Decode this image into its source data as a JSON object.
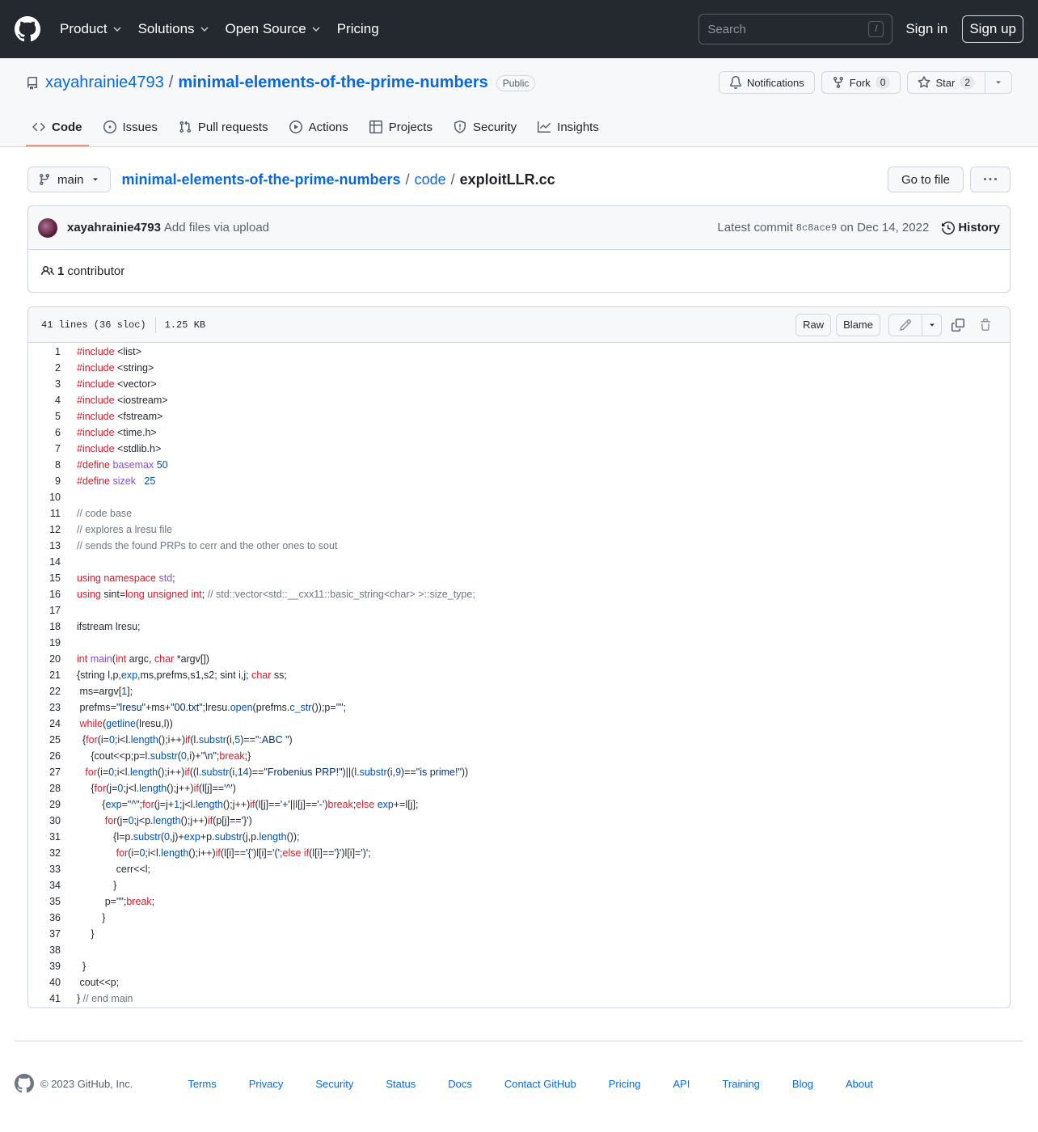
{
  "header": {
    "nav": [
      "Product",
      "Solutions",
      "Open Source",
      "Pricing"
    ],
    "search_placeholder": "Search",
    "search_shortcut": "/",
    "signin": "Sign in",
    "signup": "Sign up"
  },
  "repo": {
    "owner": "xayahrainie4793",
    "separator": "/",
    "name": "minimal-elements-of-the-prime-numbers",
    "visibility": "Public",
    "notifications_label": "Notifications",
    "fork_label": "Fork",
    "fork_count": "0",
    "star_label": "Star",
    "star_count": "2"
  },
  "tabs": [
    "Code",
    "Issues",
    "Pull requests",
    "Actions",
    "Projects",
    "Security",
    "Insights"
  ],
  "file": {
    "branch": "main",
    "breadcrumb": [
      "minimal-elements-of-the-prime-numbers",
      "code",
      "exploitLLR.cc"
    ],
    "go_to_file": "Go to file"
  },
  "commit": {
    "author": "xayahrainie4793",
    "message": "Add files via upload",
    "latest_label": "Latest commit",
    "sha": "8c8ace9",
    "date": "on Dec 14, 2022",
    "history": "History",
    "contributors_count": "1",
    "contributors_label": "contributor"
  },
  "file_view": {
    "lines_info": "41 lines (36 sloc)",
    "size": "1.25 KB",
    "raw": "Raw",
    "blame": "Blame"
  },
  "code_lines": [
    [
      [
        "k",
        "#include"
      ],
      [
        "",
        " <list>"
      ]
    ],
    [
      [
        "k",
        "#include"
      ],
      [
        "",
        " <string>"
      ]
    ],
    [
      [
        "k",
        "#include"
      ],
      [
        "",
        " <vector>"
      ]
    ],
    [
      [
        "k",
        "#include"
      ],
      [
        "",
        " <iostream>"
      ]
    ],
    [
      [
        "k",
        "#include"
      ],
      [
        "",
        " <fstream>"
      ]
    ],
    [
      [
        "k",
        "#include"
      ],
      [
        "",
        " <time.h>"
      ]
    ],
    [
      [
        "k",
        "#include"
      ],
      [
        "",
        " <stdlib.h>"
      ]
    ],
    [
      [
        "k",
        "#define"
      ],
      [
        "",
        " "
      ],
      [
        "f",
        "basemax"
      ],
      [
        "",
        " "
      ],
      [
        "b",
        "50"
      ]
    ],
    [
      [
        "k",
        "#define"
      ],
      [
        "",
        " "
      ],
      [
        "f",
        "sizek"
      ],
      [
        "",
        "   "
      ],
      [
        "b",
        "25"
      ]
    ],
    [],
    [
      [
        "cm",
        "// code base"
      ]
    ],
    [
      [
        "cm",
        "// explores a lresu file"
      ]
    ],
    [
      [
        "cm",
        "// sends the found PRPs to cerr and the other ones to sout"
      ]
    ],
    [],
    [
      [
        "k",
        "using namespace"
      ],
      [
        "",
        " "
      ],
      [
        "f",
        "std"
      ],
      [
        "",
        ";"
      ]
    ],
    [
      [
        "k",
        "using"
      ],
      [
        "",
        " sint="
      ],
      [
        "k",
        "long unsigned int"
      ],
      [
        "",
        "; "
      ],
      [
        "cm",
        "// std::vector<std::__cxx11::basic_string<char> >::size_type;"
      ]
    ],
    [],
    [
      [
        "",
        "ifstream lresu;"
      ]
    ],
    [],
    [
      [
        "k",
        "int"
      ],
      [
        "",
        " "
      ],
      [
        "f",
        "main"
      ],
      [
        "",
        "("
      ],
      [
        "k",
        "int"
      ],
      [
        "",
        " argc, "
      ],
      [
        "k",
        "char"
      ],
      [
        "",
        " *argv[])"
      ]
    ],
    [
      [
        "",
        "{string l,p,"
      ],
      [
        "b",
        "exp"
      ],
      [
        "",
        ",ms,prefms,s1,s2; sint i,j; "
      ],
      [
        "k",
        "char"
      ],
      [
        "",
        " ss;"
      ]
    ],
    [
      [
        "",
        " ms=argv["
      ],
      [
        "b",
        "1"
      ],
      [
        "",
        "];"
      ]
    ],
    [
      [
        "",
        " prefms="
      ],
      [
        "s",
        "\"lresu\""
      ],
      [
        "",
        "+ms+"
      ],
      [
        "s",
        "\"00.txt\""
      ],
      [
        "",
        ";lresu."
      ],
      [
        "b",
        "open"
      ],
      [
        "",
        "(prefms."
      ],
      [
        "b",
        "c_str"
      ],
      [
        "",
        "());p="
      ],
      [
        "s",
        "\"\""
      ],
      [
        "",
        ";"
      ]
    ],
    [
      [
        "",
        " "
      ],
      [
        "k",
        "while"
      ],
      [
        "",
        "("
      ],
      [
        "b",
        "getline"
      ],
      [
        "",
        "(lresu,l))"
      ]
    ],
    [
      [
        "",
        "  {"
      ],
      [
        "k",
        "for"
      ],
      [
        "",
        "(i="
      ],
      [
        "b",
        "0"
      ],
      [
        "",
        ";i<l."
      ],
      [
        "b",
        "length"
      ],
      [
        "",
        "();i++)"
      ],
      [
        "k",
        "if"
      ],
      [
        "",
        "(l."
      ],
      [
        "b",
        "substr"
      ],
      [
        "",
        "(i,"
      ],
      [
        "b",
        "5"
      ],
      [
        "",
        ")=="
      ],
      [
        "s",
        "\":ABC \""
      ],
      [
        "",
        ")"
      ]
    ],
    [
      [
        "",
        "     {cout<<p;p=l."
      ],
      [
        "b",
        "substr"
      ],
      [
        "",
        "("
      ],
      [
        "b",
        "0"
      ],
      [
        "",
        ",i)+"
      ],
      [
        "s",
        "\"\\n\""
      ],
      [
        "",
        ";"
      ],
      [
        "k",
        "break"
      ],
      [
        "",
        ";}"
      ]
    ],
    [
      [
        "",
        "   "
      ],
      [
        "k",
        "for"
      ],
      [
        "",
        "(i="
      ],
      [
        "b",
        "0"
      ],
      [
        "",
        ";i<l."
      ],
      [
        "b",
        "length"
      ],
      [
        "",
        "();i++)"
      ],
      [
        "k",
        "if"
      ],
      [
        "",
        "((l."
      ],
      [
        "b",
        "substr"
      ],
      [
        "",
        "(i,"
      ],
      [
        "b",
        "14"
      ],
      [
        "",
        ")=="
      ],
      [
        "s",
        "\"Frobenius PRP!\""
      ],
      [
        "",
        ")||(l."
      ],
      [
        "b",
        "substr"
      ],
      [
        "",
        "(i,"
      ],
      [
        "b",
        "9"
      ],
      [
        "",
        ")=="
      ],
      [
        "s",
        "\"is prime!\""
      ],
      [
        "",
        "))"
      ]
    ],
    [
      [
        "",
        "     {"
      ],
      [
        "k",
        "for"
      ],
      [
        "",
        "(j="
      ],
      [
        "b",
        "0"
      ],
      [
        "",
        ";j<l."
      ],
      [
        "b",
        "length"
      ],
      [
        "",
        "();j++)"
      ],
      [
        "k",
        "if"
      ],
      [
        "",
        "(l[j]=="
      ],
      [
        "s",
        "'^'"
      ],
      [
        "",
        ")"
      ]
    ],
    [
      [
        "",
        "         {"
      ],
      [
        "b",
        "exp"
      ],
      [
        "",
        "="
      ],
      [
        "s",
        "\"^\""
      ],
      [
        "",
        ";"
      ],
      [
        "k",
        "for"
      ],
      [
        "",
        "(j=j+"
      ],
      [
        "b",
        "1"
      ],
      [
        "",
        ";j<l."
      ],
      [
        "b",
        "length"
      ],
      [
        "",
        "();j++)"
      ],
      [
        "k",
        "if"
      ],
      [
        "",
        "(l[j]=="
      ],
      [
        "s",
        "'+'"
      ],
      [
        "",
        "||l[j]=="
      ],
      [
        "s",
        "'-'"
      ],
      [
        "",
        ")"
      ],
      [
        "k",
        "break"
      ],
      [
        "",
        ";"
      ],
      [
        "k",
        "else"
      ],
      [
        "",
        " "
      ],
      [
        "b",
        "exp"
      ],
      [
        "",
        "+=l[j];"
      ]
    ],
    [
      [
        "",
        "          "
      ],
      [
        "k",
        "for"
      ],
      [
        "",
        "(j="
      ],
      [
        "b",
        "0"
      ],
      [
        "",
        ";j<p."
      ],
      [
        "b",
        "length"
      ],
      [
        "",
        "();j++)"
      ],
      [
        "k",
        "if"
      ],
      [
        "",
        "(p[j]=="
      ],
      [
        "s",
        "'}'"
      ],
      [
        "",
        ")"
      ]
    ],
    [
      [
        "",
        "             {l=p."
      ],
      [
        "b",
        "substr"
      ],
      [
        "",
        "("
      ],
      [
        "b",
        "0"
      ],
      [
        "",
        ",j)+"
      ],
      [
        "b",
        "exp"
      ],
      [
        "",
        "+p."
      ],
      [
        "b",
        "substr"
      ],
      [
        "",
        "(j,p."
      ],
      [
        "b",
        "length"
      ],
      [
        "",
        "());"
      ]
    ],
    [
      [
        "",
        "              "
      ],
      [
        "k",
        "for"
      ],
      [
        "",
        "(i="
      ],
      [
        "b",
        "0"
      ],
      [
        "",
        ";i<l."
      ],
      [
        "b",
        "length"
      ],
      [
        "",
        "();i++)"
      ],
      [
        "k",
        "if"
      ],
      [
        "",
        "(l[i]=="
      ],
      [
        "s",
        "'{'"
      ],
      [
        "",
        ")l[i]="
      ],
      [
        "s",
        "'('"
      ],
      [
        "",
        ";"
      ],
      [
        "k",
        "else if"
      ],
      [
        "",
        "(l[i]=="
      ],
      [
        "s",
        "'}'"
      ],
      [
        "",
        ")l[i]="
      ],
      [
        "s",
        "')'"
      ],
      [
        "",
        ";"
      ]
    ],
    [
      [
        "",
        "              cerr<<l;"
      ]
    ],
    [
      [
        "",
        "             }"
      ]
    ],
    [
      [
        "",
        "          p="
      ],
      [
        "s",
        "\"\""
      ],
      [
        "",
        ";"
      ],
      [
        "k",
        "break"
      ],
      [
        "",
        ";"
      ]
    ],
    [
      [
        "",
        "         }"
      ]
    ],
    [
      [
        "",
        "     }"
      ]
    ],
    [],
    [
      [
        "",
        "  }"
      ]
    ],
    [
      [
        "",
        " cout<<p;"
      ]
    ],
    [
      [
        "",
        "} "
      ],
      [
        "cm",
        "// end main"
      ]
    ]
  ],
  "footer": {
    "copyright": "© 2023 GitHub, Inc.",
    "links": [
      "Terms",
      "Privacy",
      "Security",
      "Status",
      "Docs",
      "Contact GitHub",
      "Pricing",
      "API",
      "Training",
      "Blog",
      "About"
    ]
  }
}
